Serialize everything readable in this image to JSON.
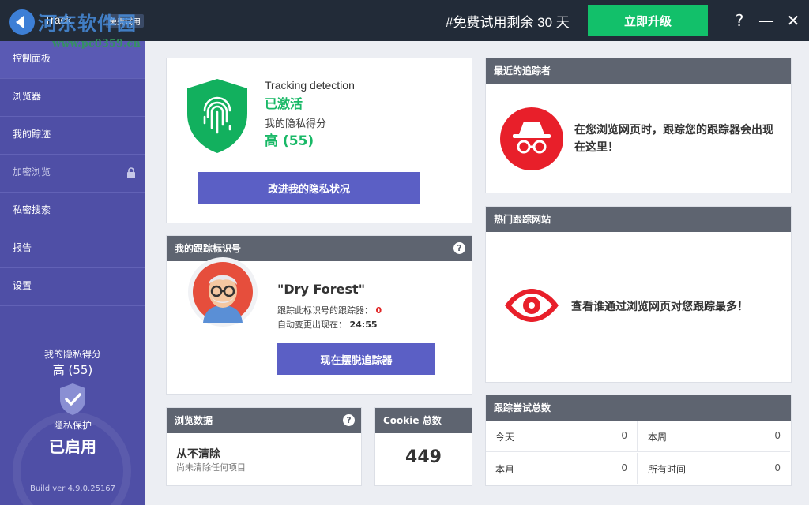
{
  "topbar": {
    "app_name": "Track",
    "badge": "免费试用",
    "watermark": "河东软件园",
    "watermark_url": "www.pc0359.cn",
    "trial_text": "#免费试用剩余 30 天",
    "upgrade_label": "立即升级",
    "help_label": "?",
    "minimize_label": "—",
    "close_label": "✕"
  },
  "sidebar": {
    "items": [
      {
        "label": "控制面板"
      },
      {
        "label": "浏览器"
      },
      {
        "label": "我的踪迹"
      },
      {
        "label": "加密浏览"
      },
      {
        "label": "私密搜索"
      },
      {
        "label": "报告"
      },
      {
        "label": "设置"
      }
    ],
    "score_label": "我的隐私得分",
    "score_value": "高 (55)",
    "protection_label": "隐私保护",
    "protection_status": "已启用",
    "build": "Build ver 4.9.0.25167"
  },
  "status": {
    "title": "Tracking detection",
    "state": "已激活",
    "score_label": "我的隐私得分",
    "score": "高 (55)",
    "button": "改进我的隐私状况"
  },
  "identity": {
    "header": "我的跟踪标识号",
    "name": "\"Dry Forest\"",
    "trackers_label": "跟踪此标识号的跟踪器：",
    "trackers_value": "0",
    "change_label": "自动变更出现在：",
    "change_value": "24:55",
    "button": "现在摆脱追踪器"
  },
  "browse_data": {
    "header": "浏览数据",
    "title": "从不清除",
    "subtitle": "尚未清除任何项目"
  },
  "cookie": {
    "header": "Cookie 总数",
    "value": "449"
  },
  "recent_trackers": {
    "header": "最近的追踪者",
    "message": "在您浏览网页时，跟踪您的跟踪器会出现在这里！"
  },
  "top_sites": {
    "header": "热门跟踪网站",
    "message": "查看谁通过浏览网页对您跟踪最多！"
  },
  "attempts": {
    "header": "跟踪尝试总数",
    "cells": [
      {
        "label": "今天",
        "value": "0"
      },
      {
        "label": "本周",
        "value": "0"
      },
      {
        "label": "本月",
        "value": "0"
      },
      {
        "label": "所有时间",
        "value": "0"
      }
    ]
  },
  "colors": {
    "accent": "#5b5fc5",
    "sidebar": "#4f4fa6",
    "green": "#18b866",
    "red": "#e02424",
    "topbar": "#222b38"
  }
}
